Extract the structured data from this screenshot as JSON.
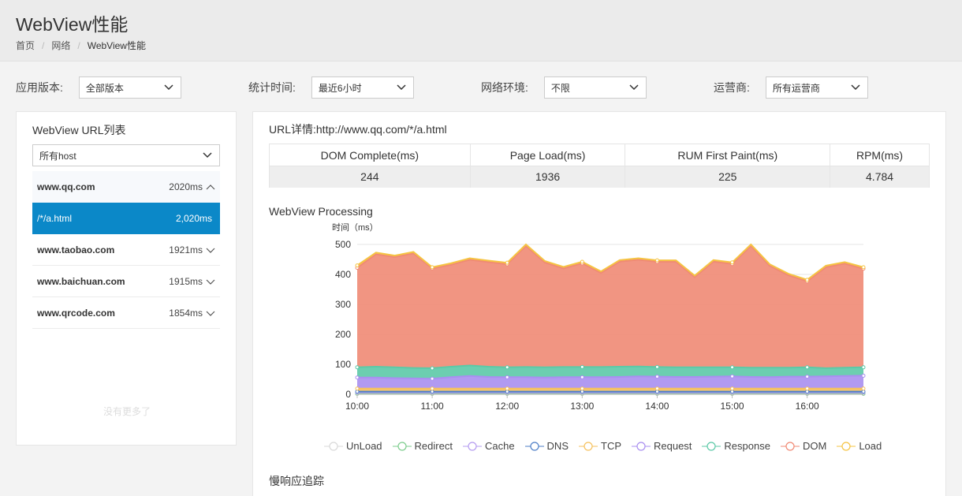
{
  "page": {
    "title": "WebView性能",
    "breadcrumb": [
      "首页",
      "网络",
      "WebView性能"
    ]
  },
  "filters": [
    {
      "label": "应用版本:",
      "value": "全部版本"
    },
    {
      "label": "统计时间:",
      "value": "最近6小时"
    },
    {
      "label": "网络环境:",
      "value": "不限"
    },
    {
      "label": "运营商:",
      "value": "所有运营商"
    }
  ],
  "url_list": {
    "title": "WebView URL列表",
    "host_select": "所有host",
    "items": [
      {
        "host": "www.qq.com",
        "time": "2020ms",
        "expanded": true,
        "sub": {
          "path": "/*/a.html",
          "time": "2,020ms"
        }
      },
      {
        "host": "www.taobao.com",
        "time": "1921ms",
        "expanded": false
      },
      {
        "host": "www.baichuan.com",
        "time": "1915ms",
        "expanded": false
      },
      {
        "host": "www.qrcode.com",
        "time": "1854ms",
        "expanded": false
      }
    ],
    "no_more": "没有更多了"
  },
  "detail": {
    "url_title": "URL详情:http://www.qq.com/*/a.html",
    "metrics": {
      "headers": [
        "DOM Complete(ms)",
        "Page Load(ms)",
        "RUM First Paint(ms)",
        "RPM(ms)"
      ],
      "values": [
        "244",
        "1936",
        "225",
        "4.784"
      ]
    },
    "chart_title": "WebView Processing",
    "slow_title": "慢响应追踪"
  },
  "chart_data": {
    "type": "area",
    "ylabel": "时间（ms）",
    "ylim": [
      0,
      500
    ],
    "yticks": [
      0,
      100,
      200,
      300,
      400,
      500
    ],
    "xlim": [
      10,
      16.75
    ],
    "xticks": [
      {
        "v": 10,
        "label": "10:00"
      },
      {
        "v": 11,
        "label": "11:00"
      },
      {
        "v": 12,
        "label": "12:00"
      },
      {
        "v": 13,
        "label": "13:00"
      },
      {
        "v": 14,
        "label": "14:00"
      },
      {
        "v": 15,
        "label": "15:00"
      },
      {
        "v": 16,
        "label": "16:00"
      }
    ],
    "x": [
      10,
      10.25,
      10.5,
      10.75,
      11,
      11.25,
      11.5,
      11.75,
      12,
      12.25,
      12.5,
      12.75,
      13,
      13.25,
      13.5,
      13.75,
      14,
      14.25,
      14.5,
      14.75,
      15,
      15.25,
      15.5,
      15.75,
      16,
      16.25,
      16.5,
      16.75
    ],
    "grid": true,
    "legend_position": "bottom",
    "series": [
      {
        "name": "UnLoad",
        "color": "#d9d9d9",
        "values": [
          1,
          1,
          1,
          1,
          1,
          1,
          1,
          1,
          1,
          1,
          1,
          1,
          1,
          1,
          1,
          1,
          1,
          1,
          1,
          1,
          1,
          1,
          1,
          1,
          1,
          1,
          1,
          1
        ]
      },
      {
        "name": "Redirect",
        "color": "#7ccc8c",
        "values": [
          1,
          1,
          1,
          1,
          1,
          1,
          1,
          1,
          1,
          1,
          1,
          1,
          1,
          1,
          1,
          1,
          1,
          1,
          1,
          1,
          1,
          1,
          1,
          1,
          1,
          1,
          1,
          1
        ]
      },
      {
        "name": "Cache",
        "color": "#b59cf0",
        "values": [
          4,
          4,
          4,
          4,
          4,
          4,
          4,
          4,
          4,
          4,
          4,
          4,
          4,
          4,
          4,
          4,
          4,
          4,
          4,
          4,
          4,
          4,
          4,
          4,
          4,
          4,
          4,
          4
        ]
      },
      {
        "name": "DNS",
        "color": "#4f7fc7",
        "values": [
          3,
          3,
          3,
          3,
          3,
          3,
          3,
          3,
          3,
          3,
          3,
          3,
          3,
          3,
          3,
          3,
          3,
          3,
          3,
          3,
          3,
          3,
          3,
          3,
          3,
          3,
          3,
          3
        ]
      },
      {
        "name": "TCP",
        "color": "#f5c15e",
        "values": [
          10,
          10,
          10,
          10,
          10,
          10,
          10,
          10,
          10,
          10,
          10,
          10,
          10,
          10,
          10,
          10,
          10,
          10,
          10,
          10,
          10,
          10,
          10,
          10,
          10,
          10,
          10,
          10
        ]
      },
      {
        "name": "Request",
        "color": "#a98ff0",
        "values": [
          37,
          37,
          35,
          34,
          33,
          38,
          42,
          39,
          38,
          38,
          37,
          38,
          38,
          38,
          39,
          41,
          40,
          39,
          39,
          40,
          41,
          39,
          38,
          40,
          40,
          41,
          42,
          43
        ]
      },
      {
        "name": "Response",
        "color": "#5cc9a7",
        "values": [
          34,
          36,
          36,
          35,
          35,
          35,
          35,
          34,
          33,
          34,
          34,
          34,
          34,
          34,
          34,
          33,
          32,
          32,
          32,
          31,
          30,
          31,
          32,
          30,
          31,
          27,
          28,
          28
        ]
      },
      {
        "name": "DOM",
        "color": "#f08a74",
        "values": [
          332,
          375,
          368,
          382,
          333,
          340,
          353,
          349,
          344,
          404,
          350,
          329,
          346,
          314,
          351,
          356,
          351,
          352,
          301,
          353,
          345,
          406,
          340,
          308,
          287,
          337,
          347,
          329
        ]
      },
      {
        "name": "Load",
        "color": "#f5c443",
        "values": [
          8,
          6,
          5,
          5,
          4,
          5,
          5,
          5,
          5,
          5,
          5,
          5,
          5,
          5,
          5,
          5,
          5,
          5,
          5,
          5,
          5,
          5,
          5,
          5,
          5,
          5,
          5,
          5
        ]
      }
    ]
  }
}
